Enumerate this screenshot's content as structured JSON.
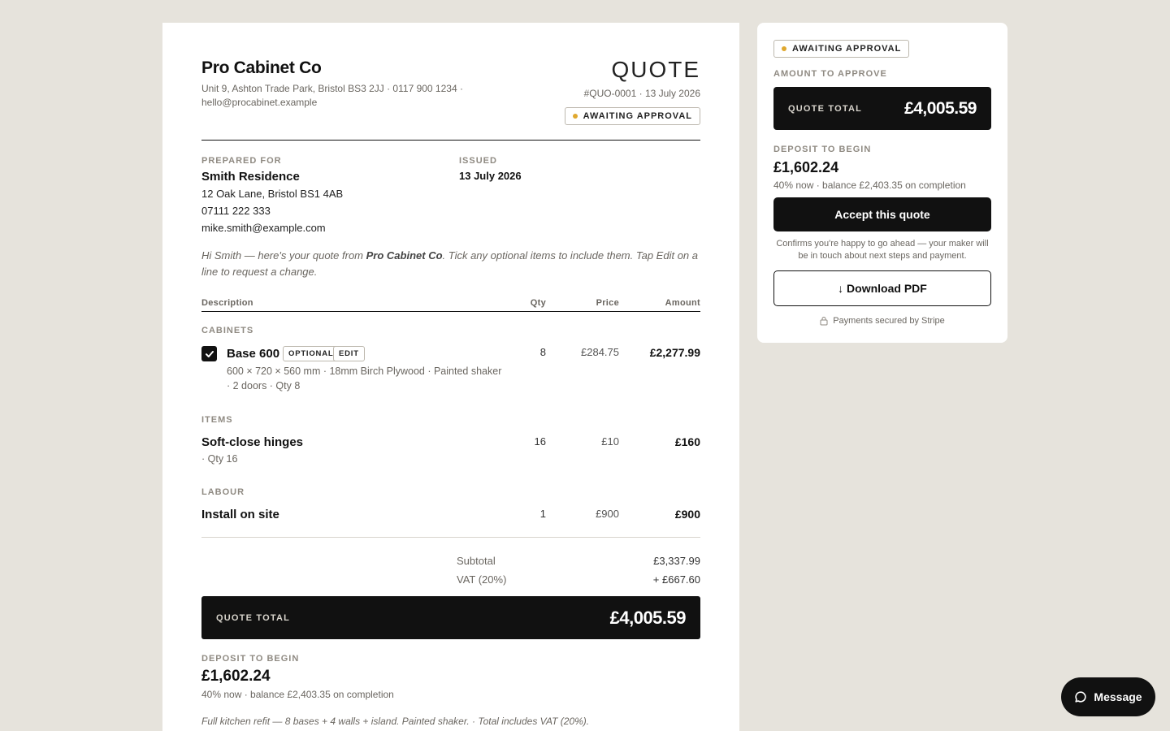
{
  "company": {
    "name": "Pro Cabinet Co",
    "address": "Unit 9, Ashton Trade Park, Bristol BS3 2JJ · 0117 900 1234 · hello@procabinet.example"
  },
  "quote": {
    "title": "QUOTE",
    "meta": "#QUO-0001 · 13 July 2026",
    "status": "AWAITING APPROVAL",
    "status_color": "#e0a82e"
  },
  "prepared_for": {
    "label": "PREPARED FOR",
    "name": "Smith Residence",
    "address": "12 Oak Lane, Bristol BS1 4AB",
    "phone": "07111 222 333",
    "email": "mike.smith@example.com"
  },
  "issued": {
    "label": "ISSUED",
    "date": "13 July 2026"
  },
  "intro": {
    "before": "Hi Smith — here's your quote from ",
    "company": "Pro Cabinet Co",
    "after": ". Tick any optional items to include them. Tap Edit on a line to request a change."
  },
  "table": {
    "headers": {
      "description": "Description",
      "qty": "Qty",
      "price": "Price",
      "amount": "Amount"
    },
    "sections": [
      {
        "label": "CABINETS",
        "items": [
          {
            "name": "Base 600",
            "checked": true,
            "optional_tag": "OPTIONAL",
            "edit_tag": "EDIT",
            "details": "600 × 720 × 560 mm · 18mm Birch Plywood · Painted shaker · 2 doors · Qty 8",
            "qty": "8",
            "price": "£284.75",
            "amount": "£2,277.99"
          }
        ]
      },
      {
        "label": "ITEMS",
        "items": [
          {
            "name": "Soft-close hinges",
            "details": "· Qty 16",
            "qty": "16",
            "price": "£10",
            "amount": "£160"
          }
        ]
      },
      {
        "label": "LABOUR",
        "items": [
          {
            "name": "Install on site",
            "details": "",
            "qty": "1",
            "price": "£900",
            "amount": "£900"
          }
        ]
      }
    ]
  },
  "totals": {
    "subtotal_label": "Subtotal",
    "subtotal": "£3,337.99",
    "vat_label": "VAT (20%)",
    "vat": "+ £667.60",
    "total_label": "QUOTE TOTAL",
    "total": "£4,005.59"
  },
  "deposit": {
    "label": "DEPOSIT TO BEGIN",
    "value": "£1,602.24",
    "note": "40% now · balance £2,403.35 on completion"
  },
  "footnote": "Full kitchen refit — 8 bases + 4 walls + island. Painted shaker. · Total includes VAT (20%).",
  "sidebar": {
    "status": "AWAITING APPROVAL",
    "amount_label": "AMOUNT TO APPROVE",
    "total_label": "QUOTE TOTAL",
    "total": "£4,005.59",
    "deposit_label": "DEPOSIT TO BEGIN",
    "deposit_value": "£1,602.24",
    "deposit_note": "40% now · balance £2,403.35 on completion",
    "accept_label": "Accept this quote",
    "confirm_note": "Confirms you're happy to go ahead — your maker will be in touch about next steps and payment.",
    "download_label": "↓ Download PDF",
    "secure_note": "Payments secured by Stripe"
  },
  "message_button": "Message",
  "icons": [
    "check-icon",
    "lock-icon",
    "chat-bubble-icon",
    "status-dot-icon"
  ]
}
